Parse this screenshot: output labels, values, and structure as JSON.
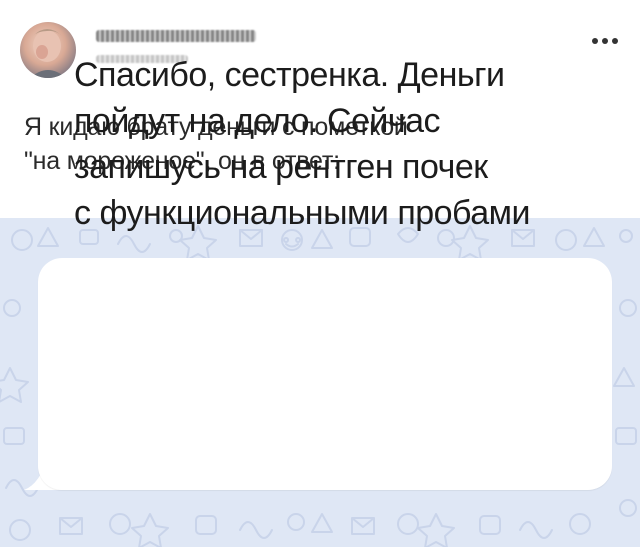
{
  "post": {
    "author": {
      "name": "",
      "handle": ""
    },
    "more_menu": {
      "icon": "more-horizontal-icon"
    },
    "text_lines": [
      "Я кидаю брату деньги с пометкой",
      "\"на мороженое\", он в ответ:"
    ]
  },
  "chat": {
    "background_color": "#dfe7f5",
    "bubble_color": "#ffffff",
    "message_lines": [
      "Спасибо, сестренка. Деньги",
      "пойдут на дело. Сейчас",
      "запишусь на рентген почек",
      "с функциональными пробами"
    ]
  }
}
